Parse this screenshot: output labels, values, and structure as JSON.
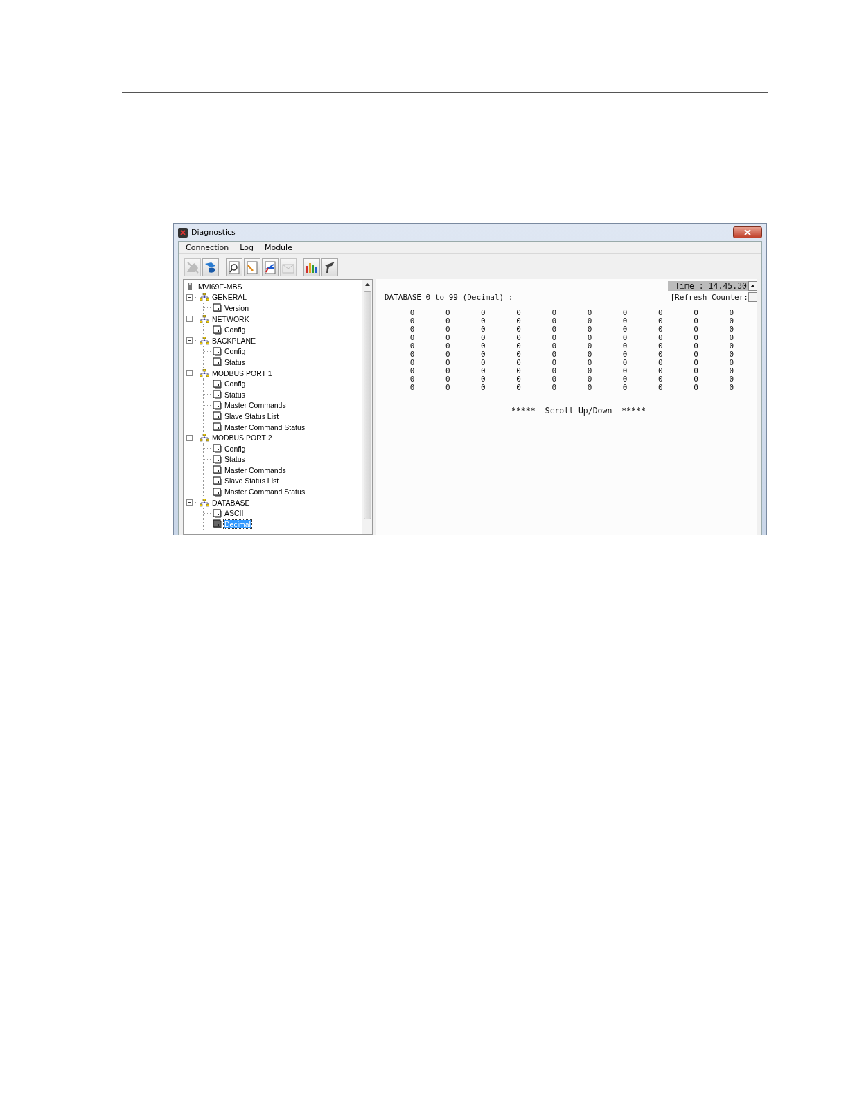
{
  "window": {
    "title": "Diagnostics"
  },
  "menu": [
    "Connection",
    "Log",
    "Module"
  ],
  "toolbar": [
    [
      {
        "kind": "disconnect",
        "disabled": true
      },
      {
        "kind": "connect",
        "disabled": false
      }
    ],
    [
      {
        "kind": "find",
        "disabled": false
      },
      {
        "kind": "edit",
        "disabled": false
      },
      {
        "kind": "transfer",
        "disabled": false
      },
      {
        "kind": "mail",
        "disabled": true
      }
    ],
    [
      {
        "kind": "chart",
        "disabled": false
      },
      {
        "kind": "tool",
        "disabled": false
      }
    ]
  ],
  "tree": {
    "label": "MVI69E-MBS",
    "children": [
      {
        "label": "GENERAL",
        "expanded": true,
        "children": [
          {
            "label": "Version",
            "selected": false
          }
        ]
      },
      {
        "label": "NETWORK",
        "expanded": true,
        "children": [
          {
            "label": "Config",
            "selected": false
          }
        ]
      },
      {
        "label": "BACKPLANE",
        "expanded": true,
        "children": [
          {
            "label": "Config",
            "selected": false
          },
          {
            "label": "Status",
            "selected": false
          }
        ]
      },
      {
        "label": "MODBUS PORT 1",
        "expanded": true,
        "children": [
          {
            "label": "Config",
            "selected": false
          },
          {
            "label": "Status",
            "selected": false
          },
          {
            "label": "Master Commands",
            "selected": false
          },
          {
            "label": "Slave Status List",
            "selected": false
          },
          {
            "label": "Master Command Status",
            "selected": false
          }
        ]
      },
      {
        "label": "MODBUS PORT 2",
        "expanded": true,
        "children": [
          {
            "label": "Config",
            "selected": false
          },
          {
            "label": "Status",
            "selected": false
          },
          {
            "label": "Master Commands",
            "selected": false
          },
          {
            "label": "Slave Status List",
            "selected": false
          },
          {
            "label": "Master Command Status",
            "selected": false
          }
        ]
      },
      {
        "label": "DATABASE",
        "expanded": true,
        "children": [
          {
            "label": "ASCII",
            "selected": false
          },
          {
            "label": "Decimal",
            "selected": true
          }
        ]
      }
    ]
  },
  "console": {
    "time": "Time : 14.45.30",
    "heading": "DATABASE 0 to 99 (Decimal) :",
    "refresh": "[Refresh Counter:",
    "rows": [
      [
        "0",
        "0",
        "0",
        "0",
        "0",
        "0",
        "0",
        "0",
        "0",
        "0"
      ],
      [
        "0",
        "0",
        "0",
        "0",
        "0",
        "0",
        "0",
        "0",
        "0",
        "0"
      ],
      [
        "0",
        "0",
        "0",
        "0",
        "0",
        "0",
        "0",
        "0",
        "0",
        "0"
      ],
      [
        "0",
        "0",
        "0",
        "0",
        "0",
        "0",
        "0",
        "0",
        "0",
        "0"
      ],
      [
        "0",
        "0",
        "0",
        "0",
        "0",
        "0",
        "0",
        "0",
        "0",
        "0"
      ],
      [
        "0",
        "0",
        "0",
        "0",
        "0",
        "0",
        "0",
        "0",
        "0",
        "0"
      ],
      [
        "0",
        "0",
        "0",
        "0",
        "0",
        "0",
        "0",
        "0",
        "0",
        "0"
      ],
      [
        "0",
        "0",
        "0",
        "0",
        "0",
        "0",
        "0",
        "0",
        "0",
        "0"
      ],
      [
        "0",
        "0",
        "0",
        "0",
        "0",
        "0",
        "0",
        "0",
        "0",
        "0"
      ],
      [
        "0",
        "0",
        "0",
        "0",
        "0",
        "0",
        "0",
        "0",
        "0",
        "0"
      ]
    ],
    "footer": "*****  Scroll Up/Down  *****"
  }
}
